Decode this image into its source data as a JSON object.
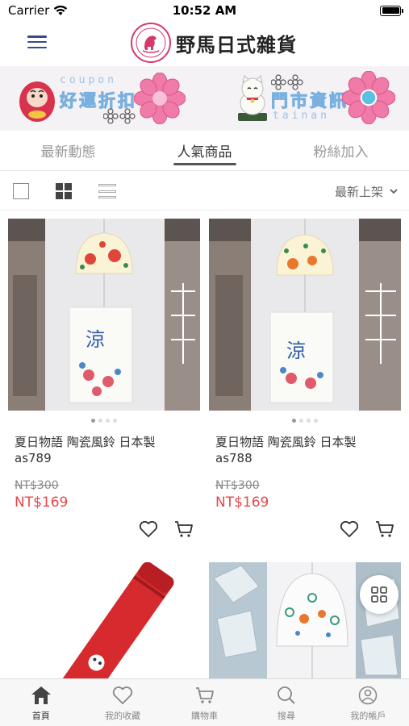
{
  "status_bar": {
    "carrier": "Carrier",
    "time": "10:52 AM"
  },
  "header": {
    "logo_text": "野馬日式雜貨",
    "logo_badge_text": "野馬日式雜貨"
  },
  "banner": {
    "left": {
      "coupon_label": "coupon",
      "title": "好運折扣"
    },
    "right": {
      "title": "門市資訊",
      "subtitle": "tainan"
    }
  },
  "tabs": [
    {
      "label": "最新動態",
      "active": false
    },
    {
      "label": "人氣商品",
      "active": true
    },
    {
      "label": "粉絲加入",
      "active": false
    }
  ],
  "toolbar": {
    "sort_label": "最新上架"
  },
  "products": [
    {
      "name": "夏日物語 陶瓷風鈴 日本製",
      "code": "as789",
      "original_price": "NT$300",
      "sale_price": "NT$169",
      "image_count": 4,
      "active_image": 1
    },
    {
      "name": "夏日物語 陶瓷風鈴 日本製",
      "code": "as788",
      "original_price": "NT$300",
      "sale_price": "NT$169",
      "image_count": 4,
      "active_image": 1
    }
  ],
  "bottom_nav": [
    {
      "label": "首頁",
      "icon": "home-icon",
      "active": true
    },
    {
      "label": "我的收藏",
      "icon": "heart-icon",
      "active": false
    },
    {
      "label": "購物車",
      "icon": "cart-icon",
      "active": false
    },
    {
      "label": "搜尋",
      "icon": "search-icon",
      "active": false
    },
    {
      "label": "我的帳戶",
      "icon": "user-icon",
      "active": false
    }
  ],
  "colors": {
    "accent": "#3a4a8c",
    "price": "#e8474a",
    "brand_pink": "#d43a6a"
  }
}
